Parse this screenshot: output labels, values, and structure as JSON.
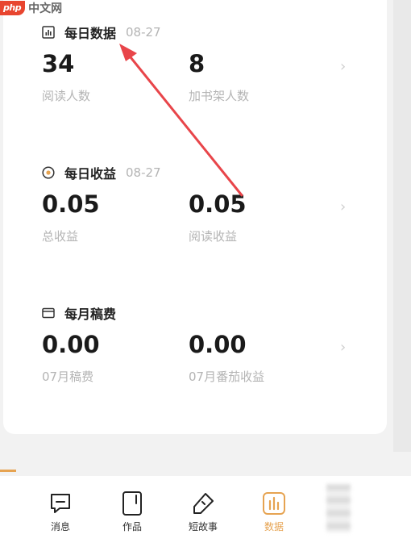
{
  "watermark": {
    "logo": "php",
    "text": "中文网"
  },
  "sections": [
    {
      "title": "每日数据",
      "date": "08-27",
      "icon": "bar-chart-icon",
      "metrics": [
        {
          "value": "34",
          "label": "阅读人数"
        },
        {
          "value": "8",
          "label": "加书架人数"
        }
      ]
    },
    {
      "title": "每日收益",
      "date": "08-27",
      "icon": "coin-icon",
      "metrics": [
        {
          "value": "0.05",
          "label": "总收益"
        },
        {
          "value": "0.05",
          "label": "阅读收益"
        }
      ]
    },
    {
      "title": "每月稿费",
      "date": "",
      "icon": "wallet-icon",
      "metrics": [
        {
          "value": "0.00",
          "label": "07月稿费"
        },
        {
          "value": "0.00",
          "label": "07月番茄收益"
        }
      ]
    }
  ],
  "chevron": "›",
  "nav": {
    "items": [
      {
        "label": "消息",
        "icon": "message-icon"
      },
      {
        "label": "作品",
        "icon": "book-icon"
      },
      {
        "label": "短故事",
        "icon": "pen-icon"
      },
      {
        "label": "数据",
        "icon": "data-icon",
        "active": true
      }
    ]
  },
  "colors": {
    "accent": "#e6a351",
    "arrow": "#e8454a",
    "muted": "#b4b4b4"
  }
}
